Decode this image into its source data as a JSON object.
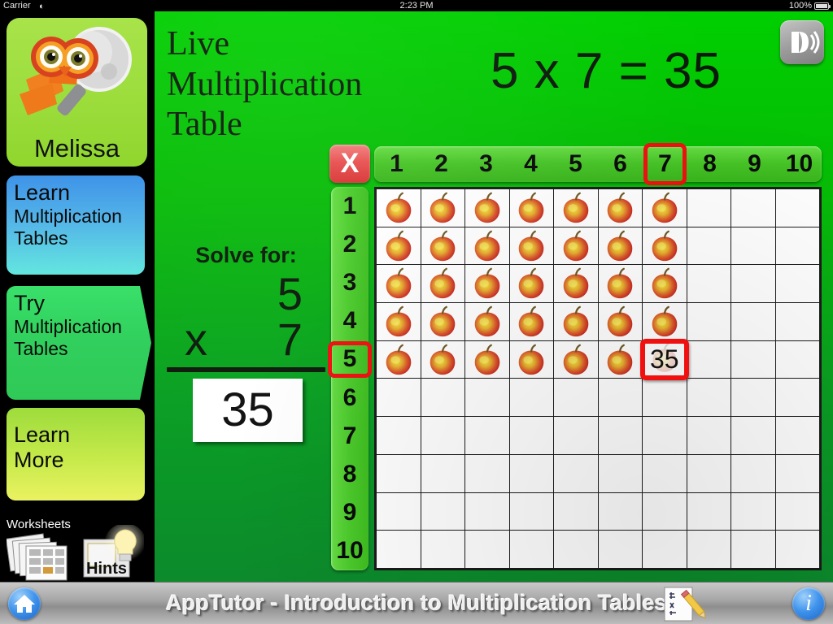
{
  "status_bar": {
    "carrier": "Carrier",
    "wifi_icon": "wifi-icon",
    "time": "2:23 PM",
    "battery_percent": "100%",
    "battery_icon": "battery-full-icon"
  },
  "sidebar": {
    "profile": {
      "name": "Melissa",
      "avatar_icon": "owl-magnifier-icon"
    },
    "nav": [
      {
        "id": "learn",
        "line1": "Learn",
        "line2": "Multiplication",
        "line3": "Tables",
        "selected": false
      },
      {
        "id": "try",
        "line1": "Try",
        "line2": "Multiplication",
        "line3": "Tables",
        "selected": true
      },
      {
        "id": "more",
        "line1": "Learn",
        "line2": "More",
        "line3": "",
        "selected": false
      }
    ],
    "worksheets": {
      "label": "Worksheets",
      "icon": "worksheets-stack-icon"
    },
    "hints": {
      "label": "Hints",
      "icon": "lightbulb-hints-icon"
    }
  },
  "stage": {
    "title_line1": "Live",
    "title_line2": "Multiplication",
    "title_line3": "Table",
    "equation": "5 x 7 = 35",
    "speaker_button_icon": "speech-speaker-icon"
  },
  "solve_panel": {
    "caption": "Solve for:",
    "operand_top": "5",
    "operator": "x",
    "operand_bottom": "7",
    "answer": "35"
  },
  "grid": {
    "corner_label": "X",
    "column_headers": [
      "1",
      "2",
      "3",
      "4",
      "5",
      "6",
      "7",
      "8",
      "9",
      "10"
    ],
    "row_headers": [
      "1",
      "2",
      "3",
      "4",
      "5",
      "6",
      "7",
      "8",
      "9",
      "10"
    ],
    "selected_column": "7",
    "selected_row": "5",
    "answer_cell": {
      "row": 5,
      "col": 7,
      "value": "35"
    },
    "apple_icon": "apple-icon",
    "filled_rows": 5,
    "filled_cols": 7
  },
  "toolbar": {
    "title": "AppTutor  -   Introduction to Multiplication Tables",
    "home_icon": "home-icon",
    "notepad_icon": "notepad-pencil-icon",
    "info_icon": "info-icon",
    "info_label": "i"
  },
  "colors": {
    "stage_green_top": "#00cf00",
    "stage_green_bottom": "#0c8a2c",
    "highlight_red": "#f01010",
    "header_green": "#46c426",
    "profile_green": "#9cdd3c",
    "learn_blue": "#3f93e8",
    "try_green": "#31cf5d",
    "more_yellow": "#c6ea4a"
  }
}
